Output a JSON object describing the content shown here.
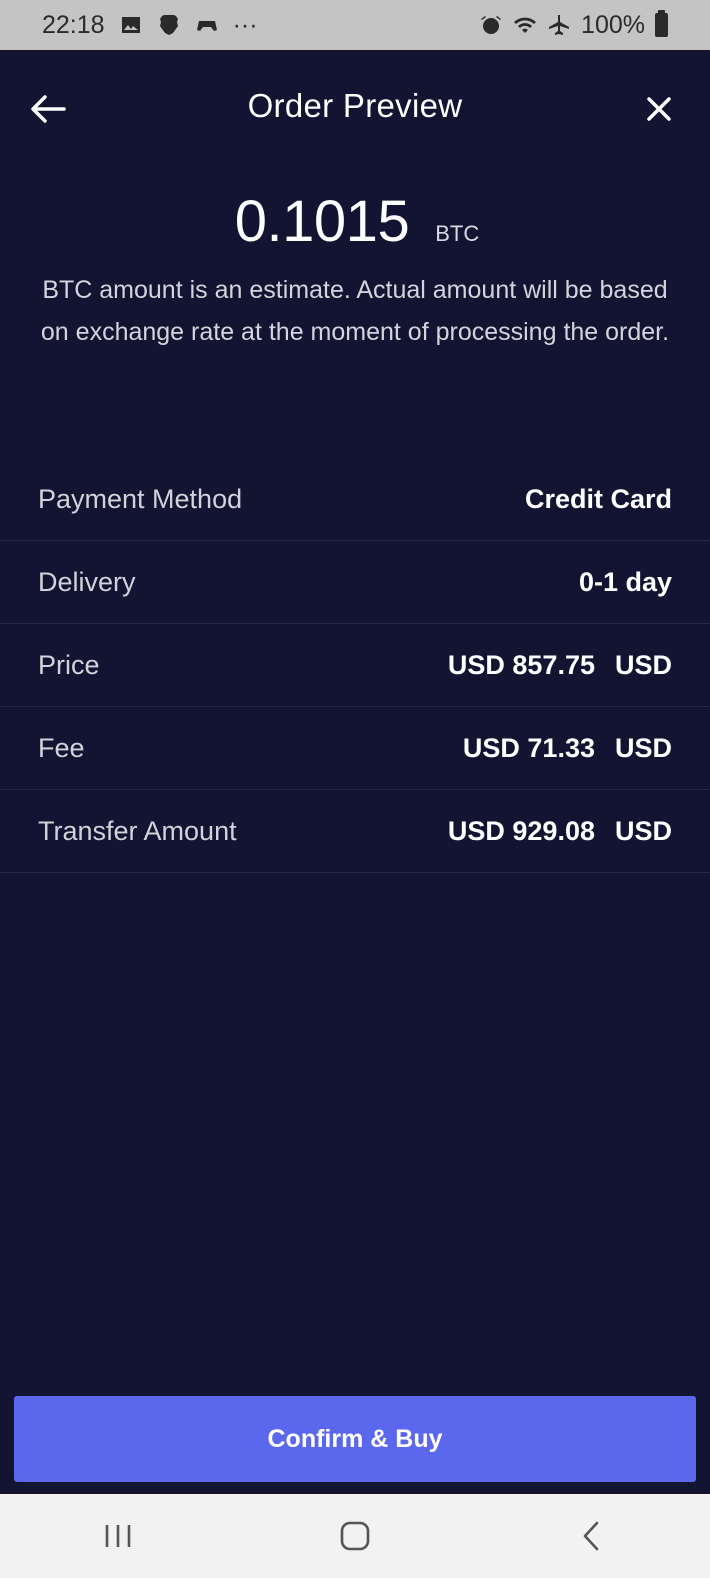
{
  "status_bar": {
    "time": "22:18",
    "more": "···",
    "battery": "100%"
  },
  "header": {
    "title": "Order Preview"
  },
  "amount": {
    "value": "0.1015",
    "unit": "BTC",
    "note": "BTC amount is an estimate. Actual amount will be based on exchange rate at the moment of processing the order."
  },
  "details": [
    {
      "label": "Payment Method",
      "value": "Credit Card",
      "suffix": ""
    },
    {
      "label": "Delivery",
      "value": "0-1 day",
      "suffix": ""
    },
    {
      "label": "Price",
      "value": "USD 857.75",
      "suffix": "USD"
    },
    {
      "label": "Fee",
      "value": "USD 71.33",
      "suffix": "USD"
    },
    {
      "label": "Transfer Amount",
      "value": "USD 929.08",
      "suffix": "USD"
    }
  ],
  "confirm": {
    "label": "Confirm & Buy"
  },
  "colors": {
    "background": "#131332",
    "accent": "#5b68ed"
  },
  "icons": {
    "back": "arrow-left-icon",
    "close": "close-icon",
    "nav_recents": "recents-icon",
    "nav_home": "home-icon",
    "nav_back": "chevron-left-icon"
  }
}
